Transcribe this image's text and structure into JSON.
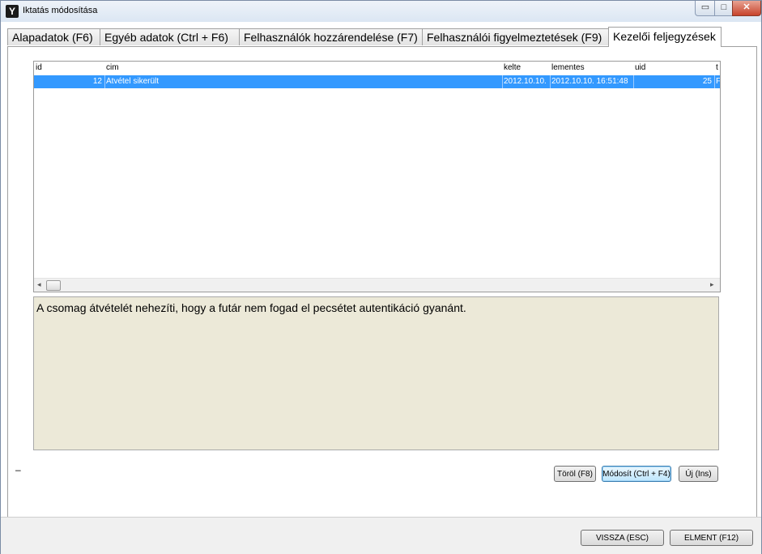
{
  "window": {
    "title": "Iktatás módosítása",
    "icon": "app-logo-icon",
    "controls": {
      "minimize": "▭",
      "maximize": "□",
      "close": "✕"
    }
  },
  "tabs": [
    {
      "label": "Alapadatok (F6)"
    },
    {
      "label": "Egyéb adatok (Ctrl + F6)"
    },
    {
      "label": "Felhasználók hozzárendelése (F7)"
    },
    {
      "label": "Felhasználói figyelmeztetések (F9)"
    },
    {
      "label": "Kezelői feljegyzések",
      "active": true
    }
  ],
  "grid": {
    "columns": [
      "id",
      "cim",
      "kelte",
      "lementes",
      "uid",
      "t"
    ],
    "rows": [
      {
        "id": "12",
        "cim": "Átvétel sikerült",
        "kelte": "2012.10.10.",
        "lementes": "2012.10.10. 16:51:48",
        "uid": "25",
        "t": "F"
      }
    ],
    "selected_row_color": "#3399ff"
  },
  "note": {
    "text": "A csomag átvételét nehezíti, hogy a futár nem fogad el pecsétet autentikáció gyanánt."
  },
  "status_dash": "–",
  "actions": {
    "delete": "Töröl (F8)",
    "modify": "Módosít (Ctrl + F4)",
    "new": "Új (Ins)"
  },
  "footer": {
    "back": "VISSZA (ESC)",
    "save": "ELMENT (F12)"
  },
  "scroll": {
    "left": "◂",
    "right": "▸"
  }
}
